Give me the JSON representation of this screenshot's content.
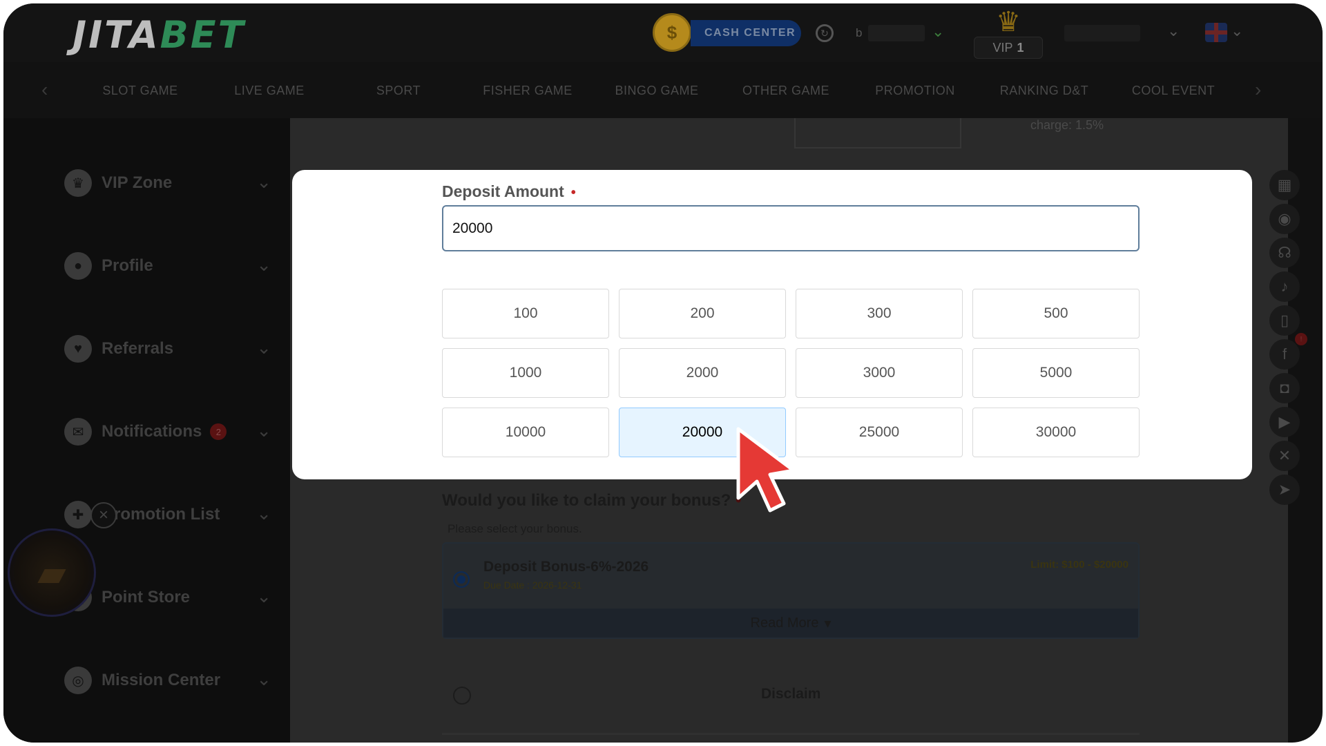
{
  "header": {
    "logo_part1": "JITA",
    "logo_part2": "BET",
    "cash_coin": "$",
    "cash_center": "CASH CENTER",
    "balance_prefix": "b",
    "vip_label": "VIP",
    "vip_level": "1"
  },
  "nav": {
    "items": [
      "SLOT GAME",
      "LIVE GAME",
      "SPORT",
      "FISHER GAME",
      "BINGO GAME",
      "OTHER GAME",
      "PROMOTION",
      "RANKING D&T",
      "COOL EVENT"
    ]
  },
  "sidebar": {
    "items": [
      {
        "label": "VIP Zone",
        "icon": "crown-icon"
      },
      {
        "label": "Profile",
        "icon": "user-icon"
      },
      {
        "label": "Referrals",
        "icon": "heart-icon"
      },
      {
        "label": "Notifications",
        "icon": "mail-icon",
        "badge": "2"
      },
      {
        "label": "romotion List",
        "icon": "gift-icon"
      },
      {
        "label": "Point Store",
        "icon": "store-icon"
      },
      {
        "label": "Mission Center",
        "icon": "target-icon"
      }
    ]
  },
  "main": {
    "top_note": "charge: 1.5%",
    "bonus_question": "Would you like to claim your bonus?",
    "bonus_hint": "Please select your bonus.",
    "bonus_title": "Deposit Bonus-6%-2026",
    "bonus_date": "Due Date : 2026-12-31",
    "bonus_limit": "Limit: $100 - $20000",
    "read_more": "Read More",
    "disclaim": "Disclaim"
  },
  "modal": {
    "label": "Deposit Amount",
    "required_mark": "•",
    "amount_value": "20000",
    "amounts": [
      "100",
      "200",
      "300",
      "500",
      "1000",
      "2000",
      "3000",
      "5000",
      "10000",
      "20000",
      "25000",
      "30000"
    ],
    "selected_amount": "20000"
  },
  "colors": {
    "selected_bg": "#e6f4ff",
    "selected_border": "#91caff",
    "required": "#c62828",
    "cursor": "#e53935"
  }
}
